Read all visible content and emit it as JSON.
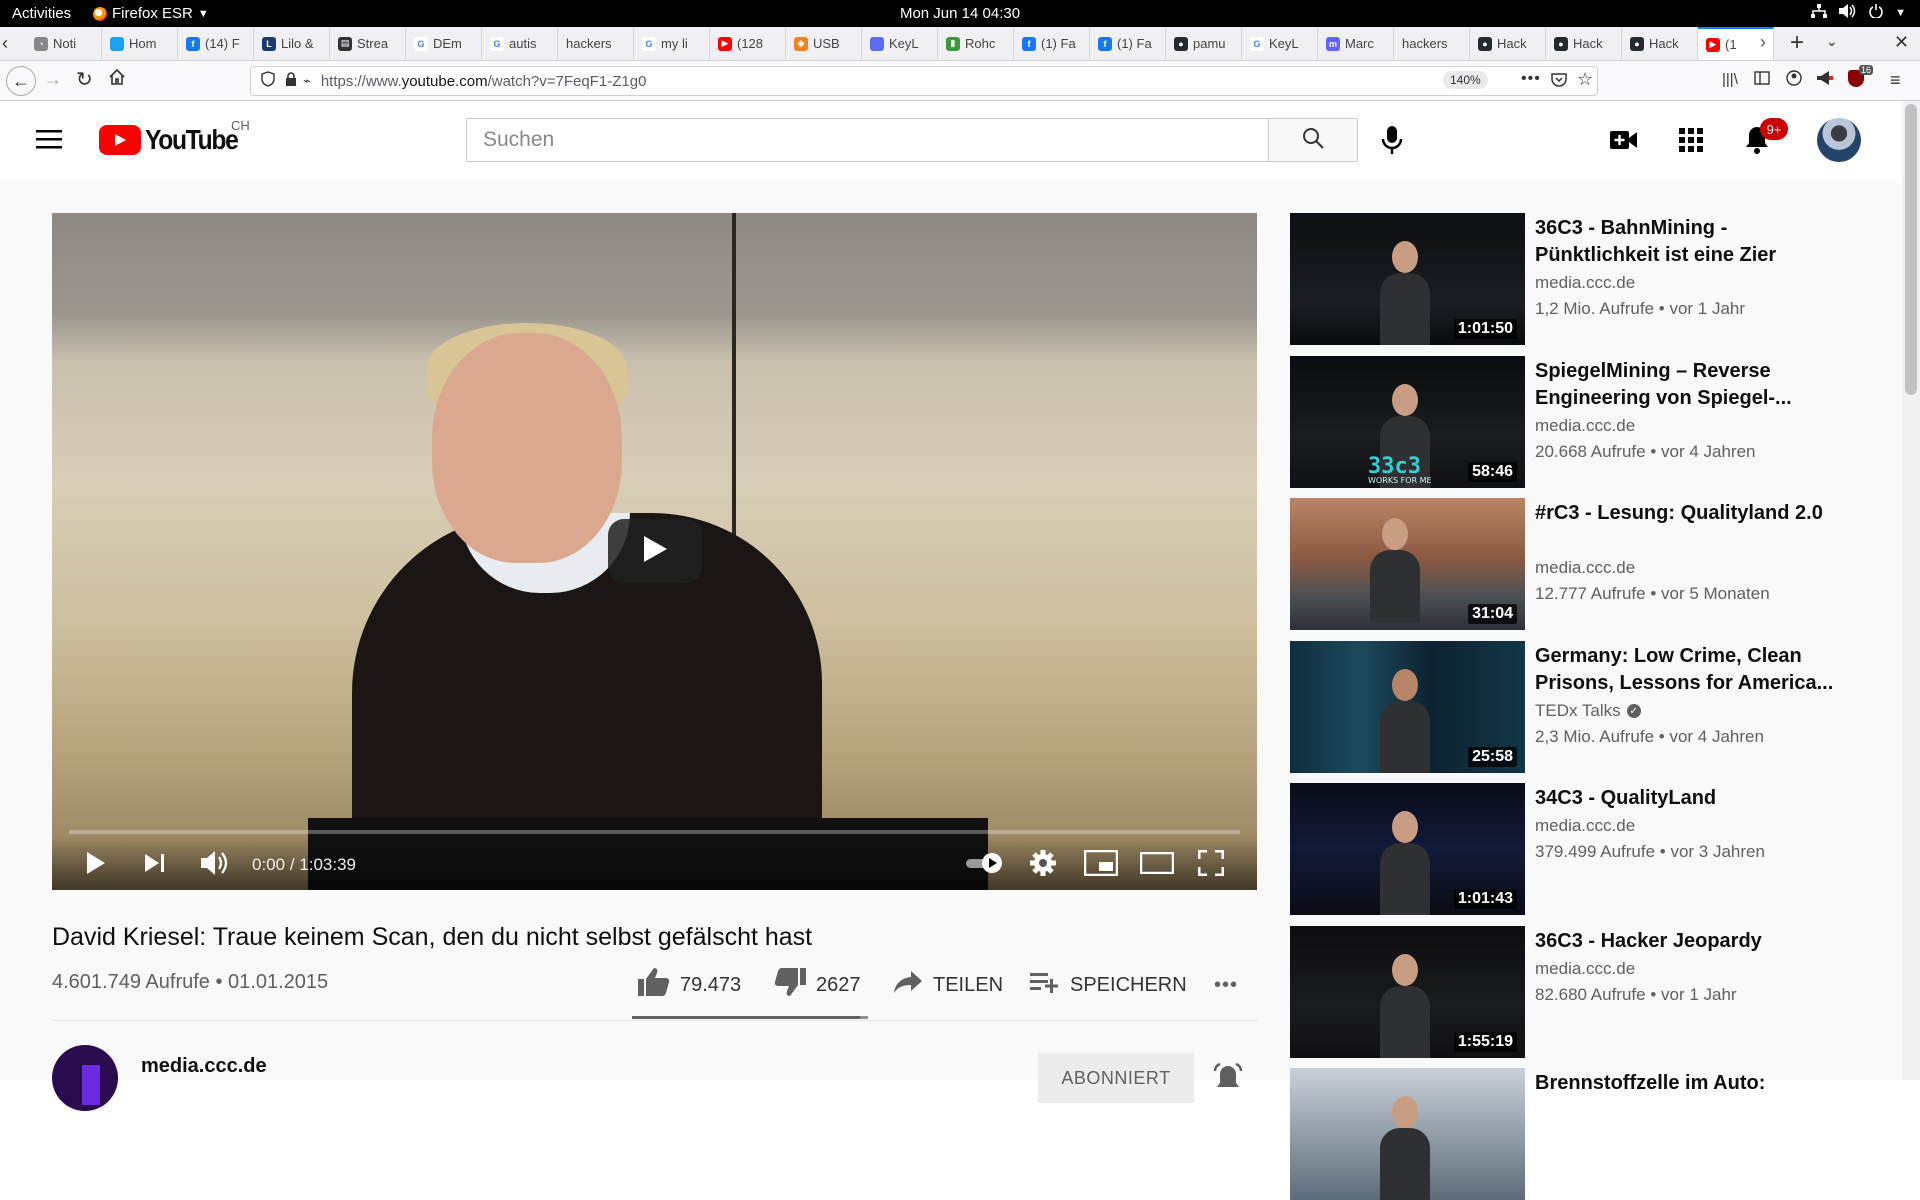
{
  "system_bar": {
    "activities": "Activities",
    "app_menu": "Firefox ESR",
    "clock": "Mon Jun 14  04:30"
  },
  "browser": {
    "tabs": [
      {
        "label": "Noti",
        "icon": "bell-icon",
        "color": "#888888"
      },
      {
        "label": "Hom",
        "icon": "twitter-icon",
        "color": "#1da1f2"
      },
      {
        "label": "(14) F",
        "icon": "facebook-icon",
        "color": "#1877f2"
      },
      {
        "label": "Lilo &",
        "icon": "lilo-icon",
        "color": "#1b3a6b"
      },
      {
        "label": "Strea",
        "icon": "stream-icon",
        "color": "#333333"
      },
      {
        "label": "DEm",
        "icon": "google-icon",
        "color": "#4285f4"
      },
      {
        "label": "autis",
        "icon": "google-icon",
        "color": "#4285f4"
      },
      {
        "label": "hackers",
        "icon": "",
        "color": "#ffffff"
      },
      {
        "label": "my li",
        "icon": "google-icon",
        "color": "#4285f4"
      },
      {
        "label": "(128",
        "icon": "youtube-icon",
        "color": "#ff0000"
      },
      {
        "label": "USB",
        "icon": "diamond-icon",
        "color": "#f58220"
      },
      {
        "label": "KeyL",
        "icon": "code-icon",
        "color": "#5a6df0"
      },
      {
        "label": "Rohc",
        "icon": "leaf-icon",
        "color": "#3c9a3c"
      },
      {
        "label": "(1) Fa",
        "icon": "facebook-icon",
        "color": "#1877f2"
      },
      {
        "label": "(1) Fa",
        "icon": "facebook-icon",
        "color": "#1877f2"
      },
      {
        "label": "pamu",
        "icon": "github-icon",
        "color": "#24292e"
      },
      {
        "label": "KeyL",
        "icon": "google-icon",
        "color": "#4285f4"
      },
      {
        "label": "Marc",
        "icon": "mastodon-icon",
        "color": "#6364ff"
      },
      {
        "label": "hackers",
        "icon": "",
        "color": "#ffffff"
      },
      {
        "label": "Hack",
        "icon": "github-icon",
        "color": "#24292e"
      },
      {
        "label": "Hack",
        "icon": "github-icon",
        "color": "#24292e"
      },
      {
        "label": "Hack",
        "icon": "github-icon",
        "color": "#24292e"
      },
      {
        "label": "(1",
        "icon": "youtube-icon",
        "color": "#ff0000",
        "active": true
      }
    ],
    "url_prefix": "https://www.",
    "url_host": "youtube.com",
    "url_path": "/watch?v=7FeqF1-Z1g0",
    "zoom": "140%",
    "notification_badge": "16"
  },
  "youtube": {
    "logo_text": "YouTube",
    "country": "CH",
    "search_placeholder": "Suchen",
    "notification_count": "9+",
    "brand_color": "#ff0000"
  },
  "video": {
    "title": "David Kriesel: Traue keinem Scan, den du nicht selbst gefälscht hast",
    "current_time": "0:00",
    "duration": "1:03:39",
    "progress": 0,
    "views_date": "4.601.749 Aufrufe • 01.01.2015",
    "likes": "79.473",
    "dislikes": "2627",
    "like_ratio": 0.968,
    "share_label": "TEILEN",
    "save_label": "SPEICHERN",
    "channel_name": "media.ccc.de",
    "subscribe_label": "ABONNIERT"
  },
  "recommendations": [
    {
      "title": "36C3 - BahnMining - Pünktlichkeit ist eine Zier",
      "channel": "media.ccc.de",
      "verified": false,
      "meta": "1,2 Mio. Aufrufe • vor 1 Jahr",
      "duration": "1:01:50"
    },
    {
      "title": "SpiegelMining – Reverse Engineering von Spiegel-...",
      "channel": "media.ccc.de",
      "verified": false,
      "meta": "20.668 Aufrufe • vor 4 Jahren",
      "duration": "58:46",
      "thumb_text": "33c3",
      "thumb_subtext": "WORKS FOR ME"
    },
    {
      "title": "#rC3 - Lesung: Qualityland 2.0",
      "channel": "media.ccc.de",
      "verified": false,
      "meta": "12.777 Aufrufe • vor 5 Monaten",
      "duration": "31:04"
    },
    {
      "title": "Germany: Low Crime, Clean Prisons, Lessons for America...",
      "channel": "TEDx Talks",
      "verified": true,
      "meta": "2,3 Mio. Aufrufe • vor 4 Jahren",
      "duration": "25:58"
    },
    {
      "title": "34C3 - QualityLand",
      "channel": "media.ccc.de",
      "verified": false,
      "meta": "379.499 Aufrufe • vor 3 Jahren",
      "duration": "1:01:43"
    },
    {
      "title": "36C3 - Hacker Jeopardy",
      "channel": "media.ccc.de",
      "verified": false,
      "meta": "82.680 Aufrufe • vor 1 Jahr",
      "duration": "1:55:19"
    },
    {
      "title": "Brennstoffzelle im Auto:",
      "channel": "",
      "verified": false,
      "meta": "",
      "duration": ""
    }
  ]
}
